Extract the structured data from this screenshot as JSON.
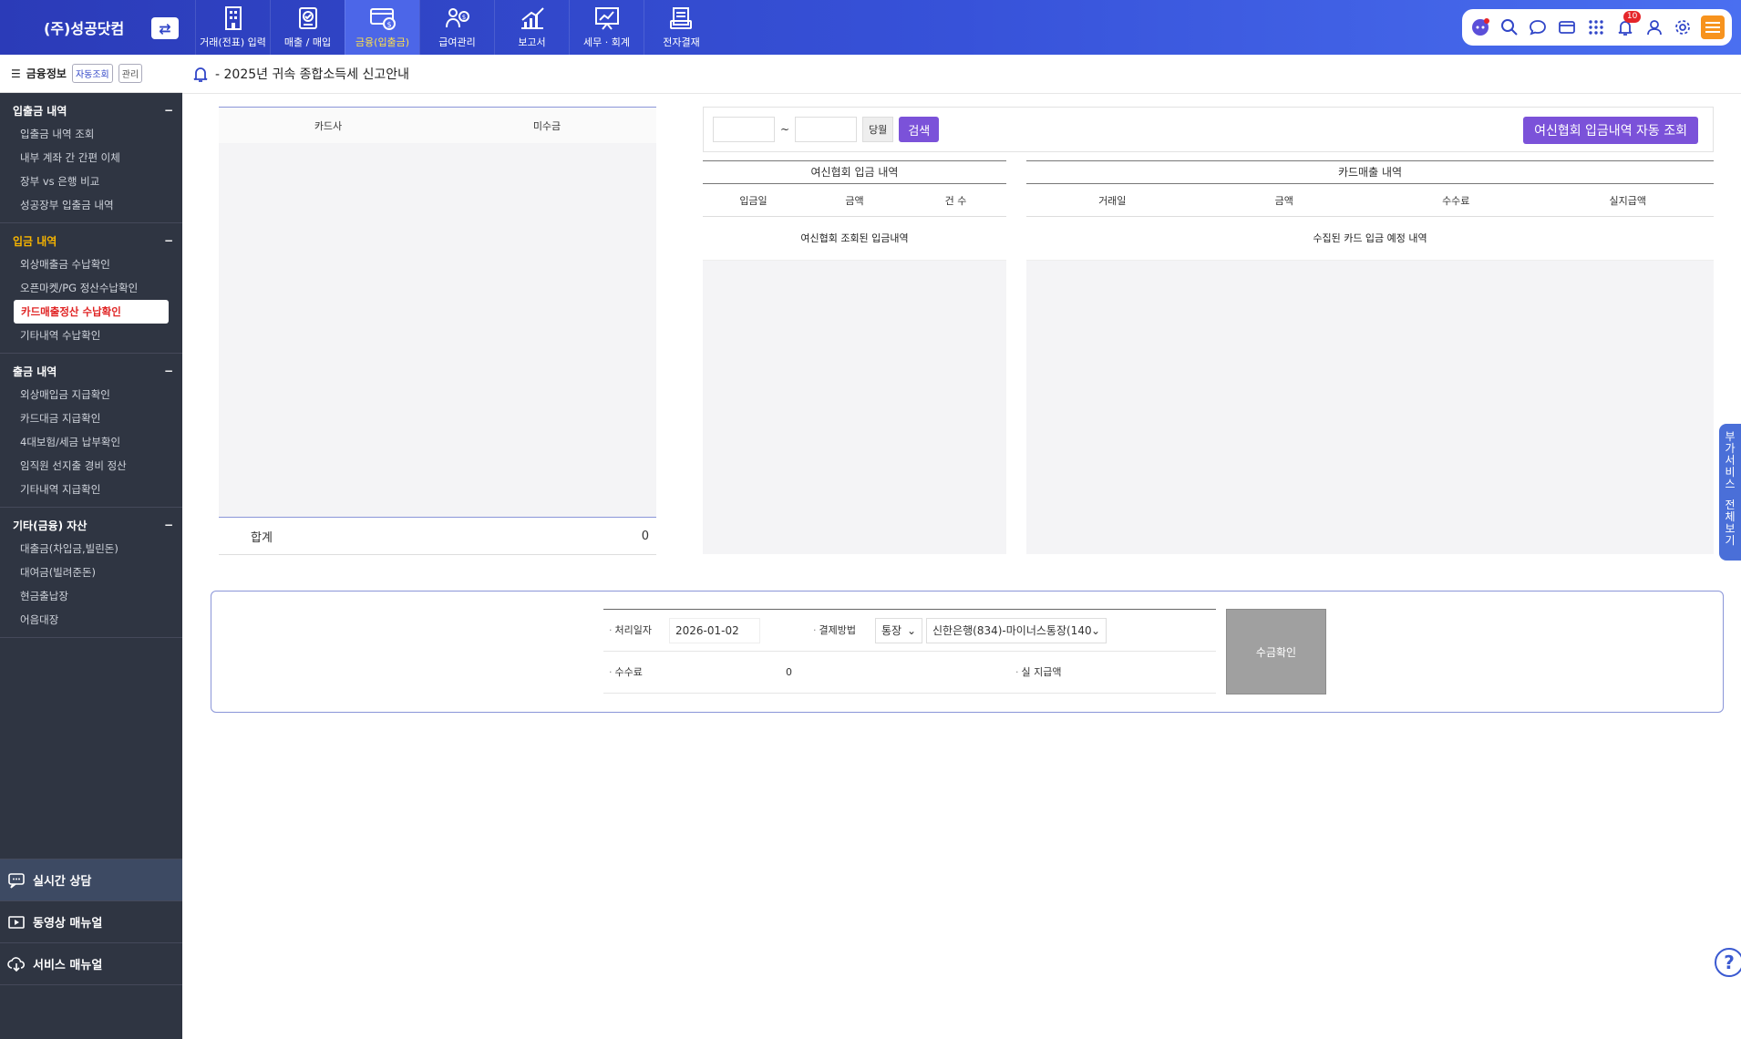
{
  "header": {
    "company": "(주)성공닷컴",
    "menus": [
      {
        "label": "거래(전표) 입력",
        "icon": "building-icon"
      },
      {
        "label": "매출 / 매입",
        "icon": "invoice-check-icon"
      },
      {
        "label": "금융(입출금)",
        "icon": "card-coin-icon"
      },
      {
        "label": "급여관리",
        "icon": "person-money-icon"
      },
      {
        "label": "보고서",
        "icon": "chart-up-icon"
      },
      {
        "label": "세무 · 회계",
        "icon": "board-chart-icon"
      },
      {
        "label": "전자결재",
        "icon": "document-stack-icon"
      }
    ],
    "notification_count": "10",
    "accent": "#3146c8"
  },
  "sidebar": {
    "header_label": "금융정보",
    "auto_label": "자동조회",
    "manage_label": "관리",
    "sections": [
      {
        "title": "입출금 내역",
        "items": [
          "입출금 내역 조회",
          "내부 계좌 간 간편 이체",
          "장부 vs 은행 비교",
          "성공장부 입출금 내역"
        ]
      },
      {
        "title": "입금 내역",
        "items": [
          "외상매출금 수납확인",
          "오픈마켓/PG 정산수납확인",
          "카드매출정산 수납확인",
          "기타내역 수납확인"
        ]
      },
      {
        "title": "출금 내역",
        "items": [
          "외상매입금 지급확인",
          "카드대금 지급확인",
          "4대보험/세금 납부확인",
          "임직원 선지출 경비 정산",
          "기타내역 지급확인"
        ]
      },
      {
        "title": "기타(금융) 자산",
        "items": [
          "대출금(차입금,빌린돈)",
          "대여금(빌려준돈)",
          "현금출납장",
          "어음대장"
        ]
      }
    ],
    "links": [
      "실시간 상담",
      "동영상 매뉴얼",
      "서비스 매뉴얼"
    ]
  },
  "notice": "- 2025년 귀속 종합소득세 신고안내",
  "left_table": {
    "headers": [
      "카드사",
      "미수금"
    ],
    "total_label": "합계",
    "total_value": "0"
  },
  "search": {
    "tilde": "~",
    "month_label": "당월",
    "search_label": "검색",
    "auto_label": "여신협회 입금내역 자동 조회"
  },
  "deposit_table": {
    "caption": "여신협회 입금 내역",
    "headers": [
      "입금일",
      "금액",
      "건 수"
    ],
    "message": "여신협회 조회된 입금내역"
  },
  "sales_table": {
    "caption": "카드매출 내역",
    "headers": [
      "거래일",
      "금액",
      "수수료",
      "실지급액"
    ],
    "message": "수집된 카드 입금 예정 내역"
  },
  "form": {
    "date_label": "처리일자",
    "date_value": "2026-01-02",
    "method_label": "결제방법",
    "method_value": "통장",
    "account_value": "신한은행(834)-마이너스통장(140",
    "fee_label": "수수료",
    "fee_value": "0",
    "net_label": "실 지급액",
    "confirm_label": "수금확인"
  },
  "side_tab": [
    "부",
    "가",
    "서",
    "비",
    "스",
    "",
    "전",
    "체",
    "보",
    "기"
  ],
  "help": "?"
}
